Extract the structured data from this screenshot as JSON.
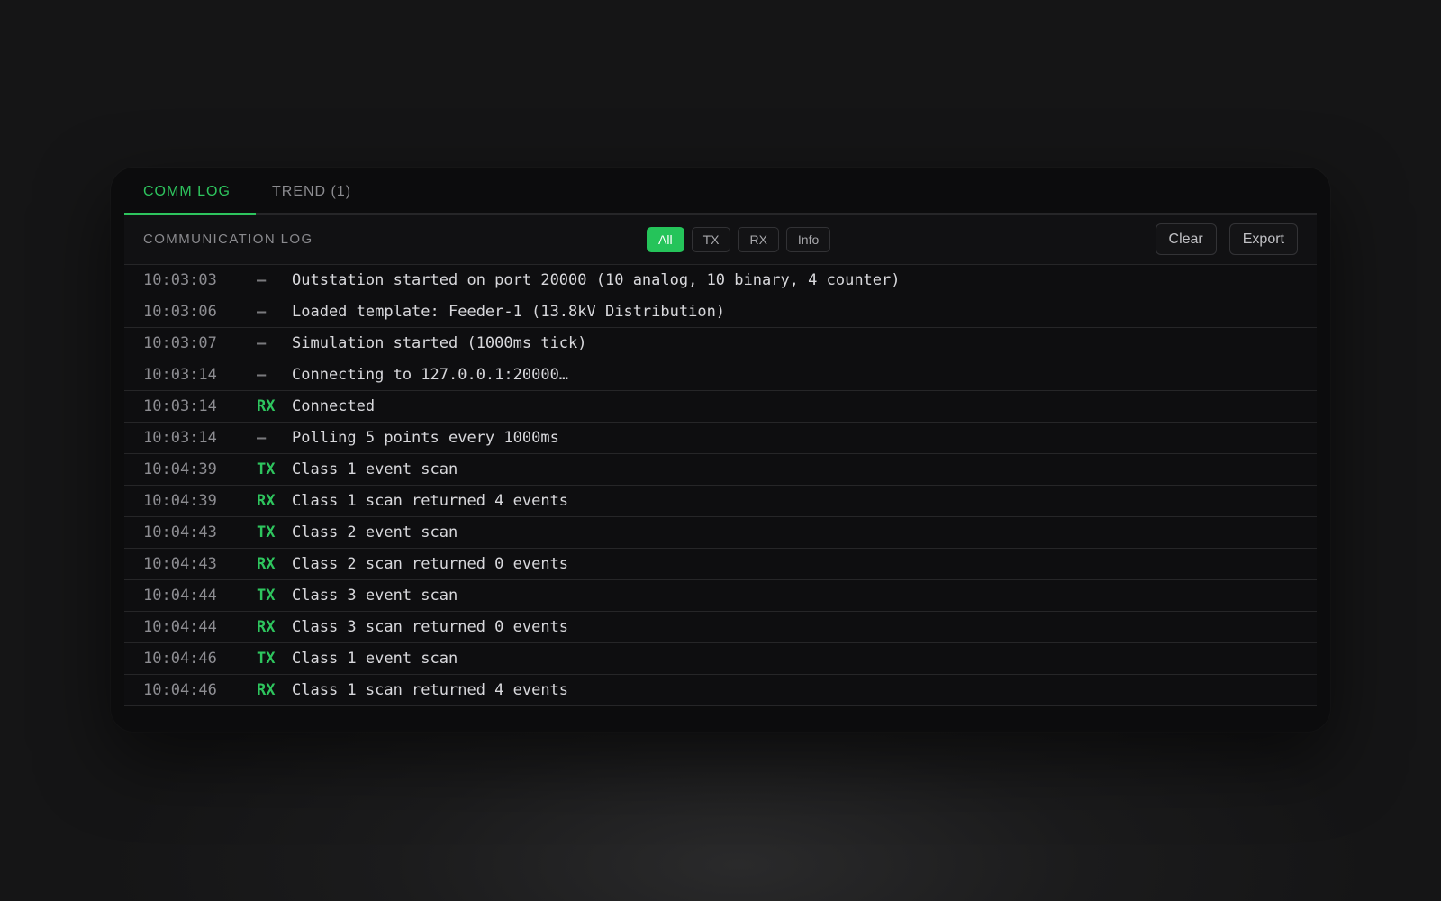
{
  "tabs": [
    {
      "label": "COMM LOG",
      "active": true
    },
    {
      "label": "TREND (1)",
      "active": false
    }
  ],
  "toolbar": {
    "title": "COMMUNICATION LOG",
    "filters": [
      {
        "label": "All",
        "active": true
      },
      {
        "label": "TX",
        "active": false
      },
      {
        "label": "RX",
        "active": false
      },
      {
        "label": "Info",
        "active": false
      }
    ],
    "clear_label": "Clear",
    "export_label": "Export"
  },
  "colors": {
    "accent": "#2ec55e",
    "background": "#0c0c0d"
  },
  "log": [
    {
      "time": "10:03:03",
      "dir": "—",
      "msg": "Outstation started on port 20000 (10 analog, 10 binary, 4 counter)"
    },
    {
      "time": "10:03:06",
      "dir": "—",
      "msg": "Loaded template: Feeder-1 (13.8kV Distribution)"
    },
    {
      "time": "10:03:07",
      "dir": "—",
      "msg": "Simulation started (1000ms tick)"
    },
    {
      "time": "10:03:14",
      "dir": "—",
      "msg": "Connecting to 127.0.0.1:20000…"
    },
    {
      "time": "10:03:14",
      "dir": "RX",
      "msg": "Connected"
    },
    {
      "time": "10:03:14",
      "dir": "—",
      "msg": "Polling 5 points every 1000ms"
    },
    {
      "time": "10:04:39",
      "dir": "TX",
      "msg": "Class 1 event scan"
    },
    {
      "time": "10:04:39",
      "dir": "RX",
      "msg": "Class 1 scan returned 4 events"
    },
    {
      "time": "10:04:43",
      "dir": "TX",
      "msg": "Class 2 event scan"
    },
    {
      "time": "10:04:43",
      "dir": "RX",
      "msg": "Class 2 scan returned 0 events"
    },
    {
      "time": "10:04:44",
      "dir": "TX",
      "msg": "Class 3 event scan"
    },
    {
      "time": "10:04:44",
      "dir": "RX",
      "msg": "Class 3 scan returned 0 events"
    },
    {
      "time": "10:04:46",
      "dir": "TX",
      "msg": "Class 1 event scan"
    },
    {
      "time": "10:04:46",
      "dir": "RX",
      "msg": "Class 1 scan returned 4 events"
    }
  ]
}
